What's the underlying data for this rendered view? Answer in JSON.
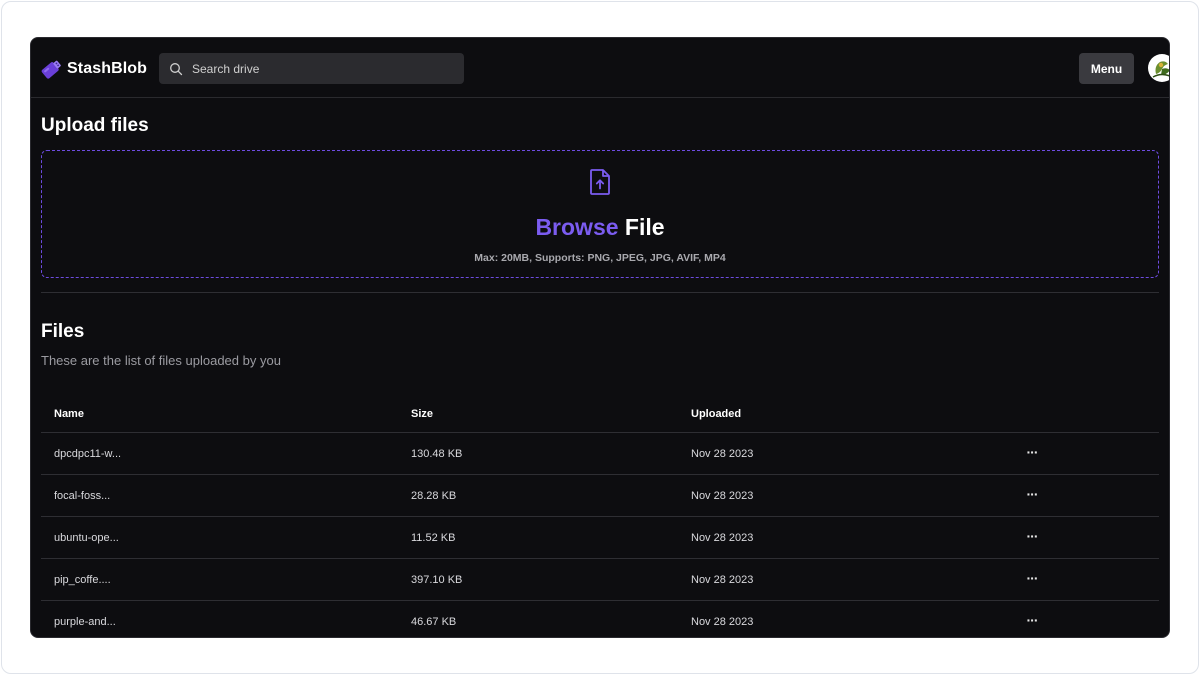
{
  "header": {
    "brand": "StashBlob",
    "search_placeholder": "Search drive",
    "menu_label": "Menu"
  },
  "upload": {
    "title": "Upload files",
    "browse_label": "Browse",
    "file_label": "File",
    "hint": "Max: 20MB, Supports: PNG, JPEG, JPG, AVIF, MP4"
  },
  "files": {
    "title": "Files",
    "subtitle": "These are the list of files uploaded by you",
    "columns": {
      "name": "Name",
      "size": "Size",
      "uploaded": "Uploaded"
    },
    "action_label": "···",
    "rows": [
      {
        "name": "dpcdpc11-w...",
        "size": "130.48 KB",
        "uploaded": "Nov 28 2023"
      },
      {
        "name": "focal-foss...",
        "size": "28.28 KB",
        "uploaded": "Nov 28 2023"
      },
      {
        "name": "ubuntu-ope...",
        "size": "11.52 KB",
        "uploaded": "Nov 28 2023"
      },
      {
        "name": "pip_coffe....",
        "size": "397.10 KB",
        "uploaded": "Nov 28 2023"
      },
      {
        "name": "purple-and...",
        "size": "46.67 KB",
        "uploaded": "Nov 28 2023"
      }
    ]
  },
  "colors": {
    "background": "#0d0d10",
    "accent": "#7b5cf0",
    "surface": "#2b2b2f",
    "divider": "#2e2e33"
  },
  "icons": {
    "logo": "usb-drive-icon",
    "search": "search-icon",
    "upload": "file-upload-icon",
    "row_action": "more-horizontal-icon"
  }
}
